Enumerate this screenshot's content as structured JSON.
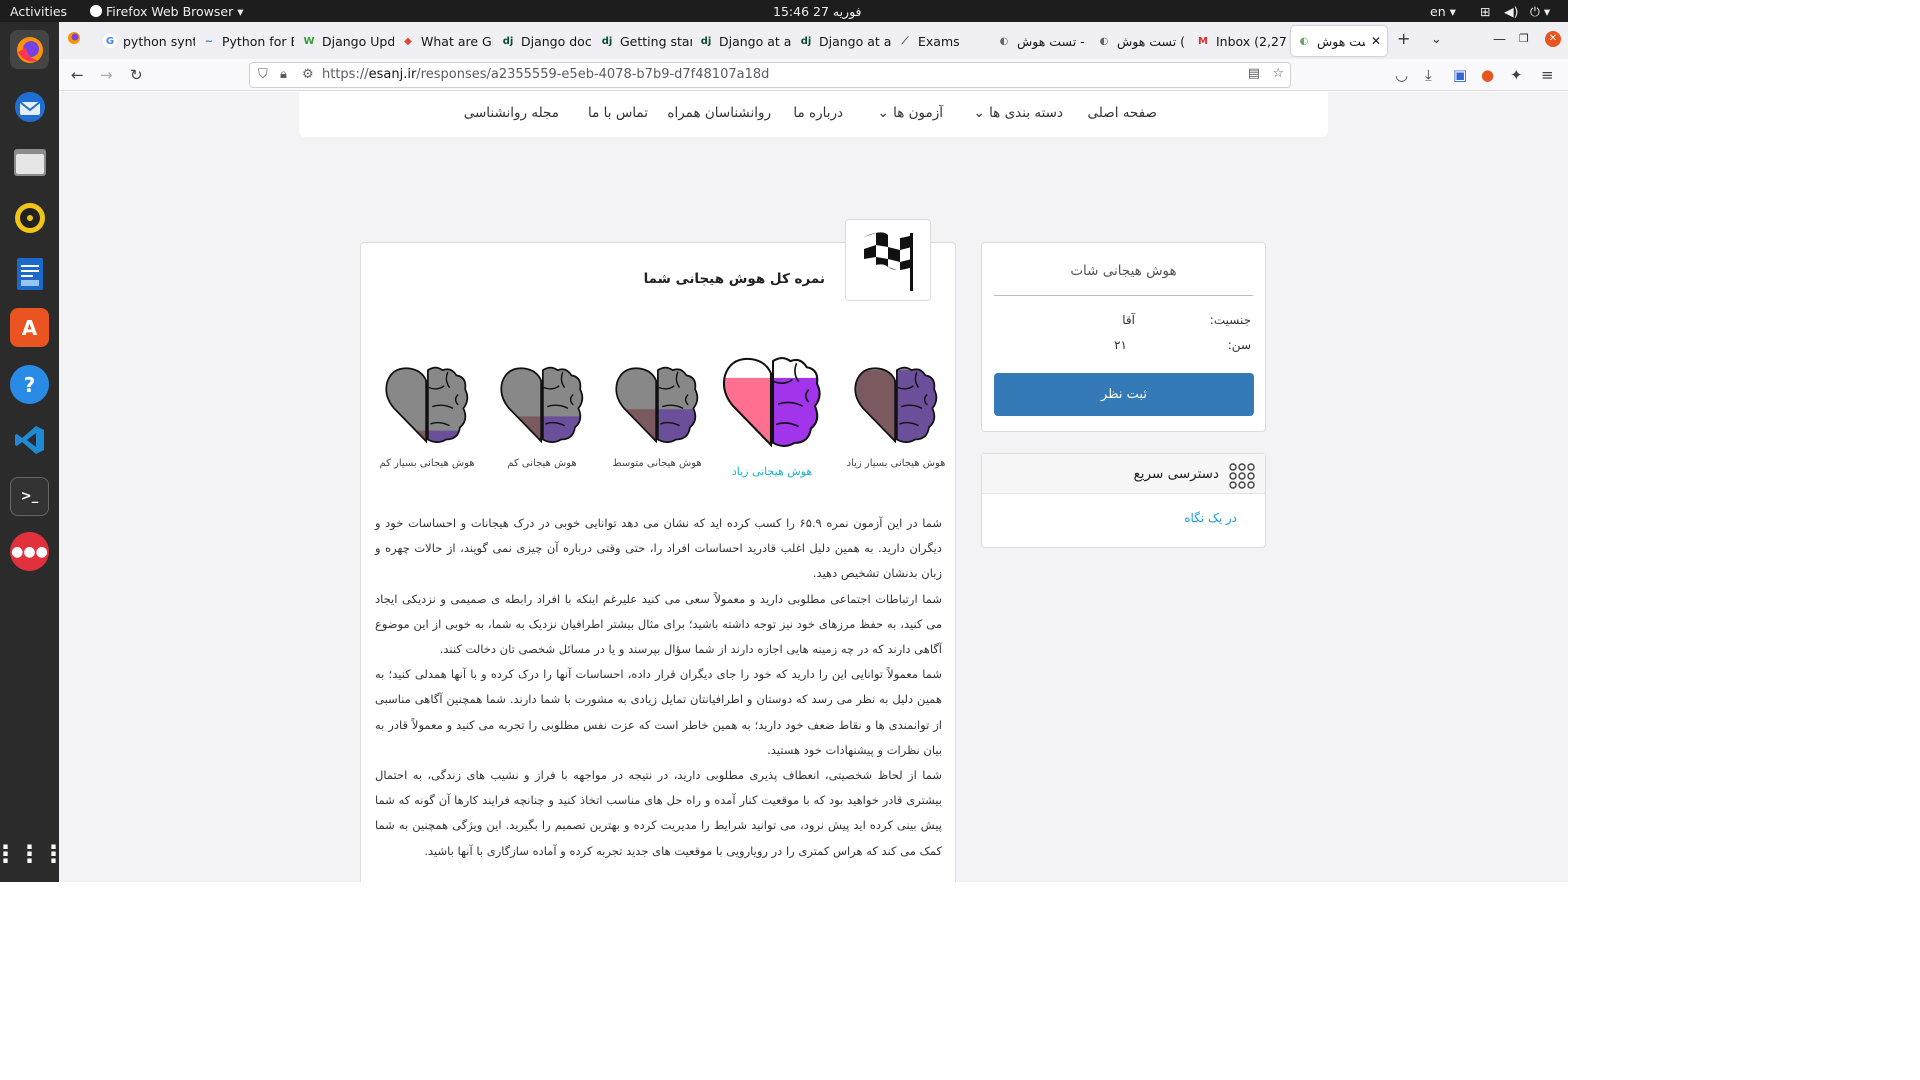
{
  "system_bar": {
    "activities": "Activities",
    "app_name": "Firefox Web Browser",
    "clock": "15:46  فوریه 27",
    "language": "en"
  },
  "dock": {
    "items": [
      "firefox-icon",
      "thunderbird-icon",
      "files-icon",
      "rhythmbox-icon",
      "writer-icon",
      "app-center-icon",
      "help-icon",
      "vscode-icon",
      "terminal-icon",
      "chat-icon",
      "show-apps-icon"
    ]
  },
  "tabs": [
    {
      "label": "python synt"
    },
    {
      "label": "Python for E"
    },
    {
      "label": "Django Upd"
    },
    {
      "label": "What are Gi"
    },
    {
      "label": "Django doc"
    },
    {
      "label": "Getting star"
    },
    {
      "label": "Django at a"
    },
    {
      "label": "Django at a"
    },
    {
      "label": "Exams"
    },
    {
      "label": "تست هوش -"
    },
    {
      "label": "تست هوش ("
    },
    {
      "label": "Inbox (2,27"
    },
    {
      "label": "تست هوش"
    }
  ],
  "url": {
    "prefix": "https://",
    "domain": "esanj.ir",
    "path": "/responses/a2355559-e5eb-4078-b7b9-d7f48107a18d"
  },
  "site_menu": [
    {
      "label": "صفحه اصلی"
    },
    {
      "label": "دسته بندی ها"
    },
    {
      "label": "آزمون ها"
    },
    {
      "label": "درباره ما"
    },
    {
      "label": "روانشناسان همراه"
    },
    {
      "label": "تماس با ما"
    },
    {
      "label": "مجله روانشناسی"
    }
  ],
  "result": {
    "title": "نمره کل هوش هیجانی شما",
    "levels": [
      {
        "label": "هوش هیجانی بسیار زیاد",
        "fill": 1.0
      },
      {
        "label": "هوش هیجانی زیاد",
        "fill": 0.8,
        "selected": true
      },
      {
        "label": "هوش هیجانی متوسط",
        "fill": 0.45
      },
      {
        "label": "هوش هیجانی کم",
        "fill": 0.35
      },
      {
        "label": "هوش هیجانی بسیار کم",
        "fill": 0.15
      }
    ],
    "paragraphs": [
      "شما در این آزمون نمره ۶۵.۹ را کسب کرده اید که نشان می دهد توانایی خوبی در درک هیجانات و احساسات خود و دیگران دارید. به همین دلیل اغلب قادرید احساسات افراد را، حتی وقتی درباره آن چیزی نمی گویند، از حالات چهره و زبان بدنشان تشخیص دهید.",
      "شما ارتباطات اجتماعی مطلوبی دارید و معمولاً سعی می کنید علیرغم اینکه با افراد رابطه ی صمیمی و نزدیکی ایجاد می کنید، به حفظ مرزهای خود نیز توجه داشته باشید؛ برای مثال بیشتر اطرافیان نزدیک به شما، به خوبی از این موضوع آگاهی دارند که در چه زمینه هایی اجازه دارند از شما سؤال بپرسند و یا در مسائل شخصی تان دخالت کنند.",
      "شما معمولاً توانایی این را دارید که خود را جای دیگران قرار داده، احساسات آنها را درک کرده و با آنها همدلی کنید؛ به همین دلیل به نظر می رسد که دوستان و اطرافیانتان تمایل زیادی به مشورت با شما دارند. شما همچنین آگاهی مناسبی از توانمندی ها و نقاط ضعف خود دارید؛ به همین خاطر است که عزت نفس مطلوبی را تجربه می کنید و معمولاً قادر به بیان نظرات و پیشنهادات خود هستید.",
      "شما از لحاظ شخصیتی، انعطاف پذیری مطلوبی دارید، در نتیجه در مواجهه با فراز و نشیب های زندگی، به احتمال بیشتری قادر خواهید بود که با موقعیت کنار آمده و راه حل های مناسب اتخاذ کنید و چنانچه فرایند کارها آن گونه که شما پیش بینی کرده اید پیش نرود، می توانید شرایط را مدیریت کرده و بهترین تصمیم را بگیرید. این ویژگی همچنین به شما کمک می کند که هراس کمتری را در رویارویی با موقعیت های جدید تجربه کرده و آماده سازگاری با آنها باشید."
    ]
  },
  "sidebar": {
    "title": "هوش هیجانی شات",
    "gender_label": "جنسیت:",
    "gender_value": "آقا",
    "age_label": "سن:",
    "age_value": "۲۱",
    "submit_button": "ثبت نظر",
    "quick_access_title": "دسترسی سریع",
    "quick_link": "در یک نگاه"
  },
  "colors": {
    "accent_blue": "#337ab7",
    "heart_pink": "#ff6f8f",
    "brain_purple": "#a235ec",
    "selected_label": "#1ab5c8"
  }
}
